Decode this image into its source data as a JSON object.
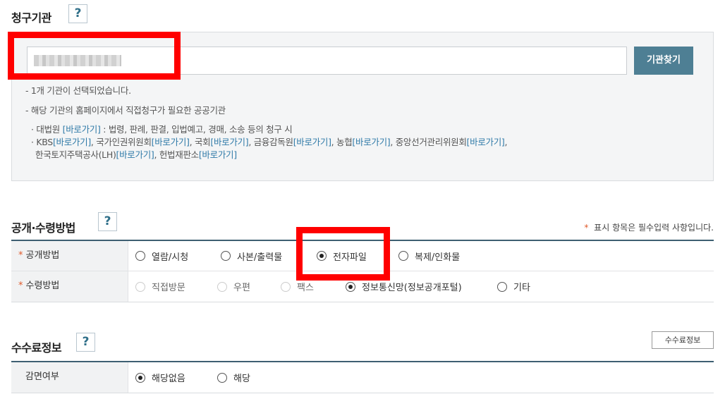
{
  "agency_section": {
    "title": "청구기관",
    "help_label": "?",
    "input_value": "",
    "find_button": "기관찾기",
    "selected_note": "- 1개 기관이 선택되었습니다.",
    "direct_note": "- 해당 기관의 홈페이지에서 직접청구가 필요한 공공기관",
    "line1_prefix": "· 대법원 ",
    "line1_link": "[바로가기]",
    "line1_suffix": " : 법령, 판례, 판결, 입법예고, 경매, 소송 등의 청구 시",
    "line2_parts": [
      {
        "text": "· KBS",
        "link": "[바로가기]"
      },
      {
        "text": ", 국가인권위원회",
        "link": "[바로가기]"
      },
      {
        "text": ", 국회",
        "link": "[바로가기]"
      },
      {
        "text": ", 금융감독원",
        "link": "[바로가기]"
      },
      {
        "text": ", 농협",
        "link": "[바로가기]"
      },
      {
        "text": ", 중앙선거관리위원회",
        "link": "[바로가기]"
      }
    ],
    "line2_end": ",",
    "line3_parts": [
      {
        "text": "한국토지주택공사(LH)",
        "link": "[바로가기]"
      },
      {
        "text": ", 헌법재판소",
        "link": "[바로가기]"
      }
    ]
  },
  "disclosure_section": {
    "title": "공개·수령방법",
    "help_label": "?",
    "required_note_star": "*",
    "required_note": " 표시 항목은 필수입력 사항입니다.",
    "rows": [
      {
        "label": "공개방법",
        "options": [
          "열람/시청",
          "사본/출력물",
          "전자파일",
          "복제/인화물"
        ],
        "selected": "전자파일"
      },
      {
        "label": "수령방법",
        "options": [
          "직접방문",
          "우편",
          "팩스",
          "정보통신망(정보공개포털)",
          "기타"
        ],
        "selected": "정보통신망(정보공개포털)"
      }
    ]
  },
  "fee_section": {
    "title": "수수료정보",
    "help_label": "?",
    "info_button": "수수료정보",
    "row_label": "감면여부",
    "options": [
      "해당없음",
      "해당"
    ],
    "selected": "해당없음"
  },
  "colors": {
    "accent": "#4e7f94",
    "link": "#2f7aa8",
    "annotation": "#ff0000",
    "required": "#e05a2b"
  }
}
